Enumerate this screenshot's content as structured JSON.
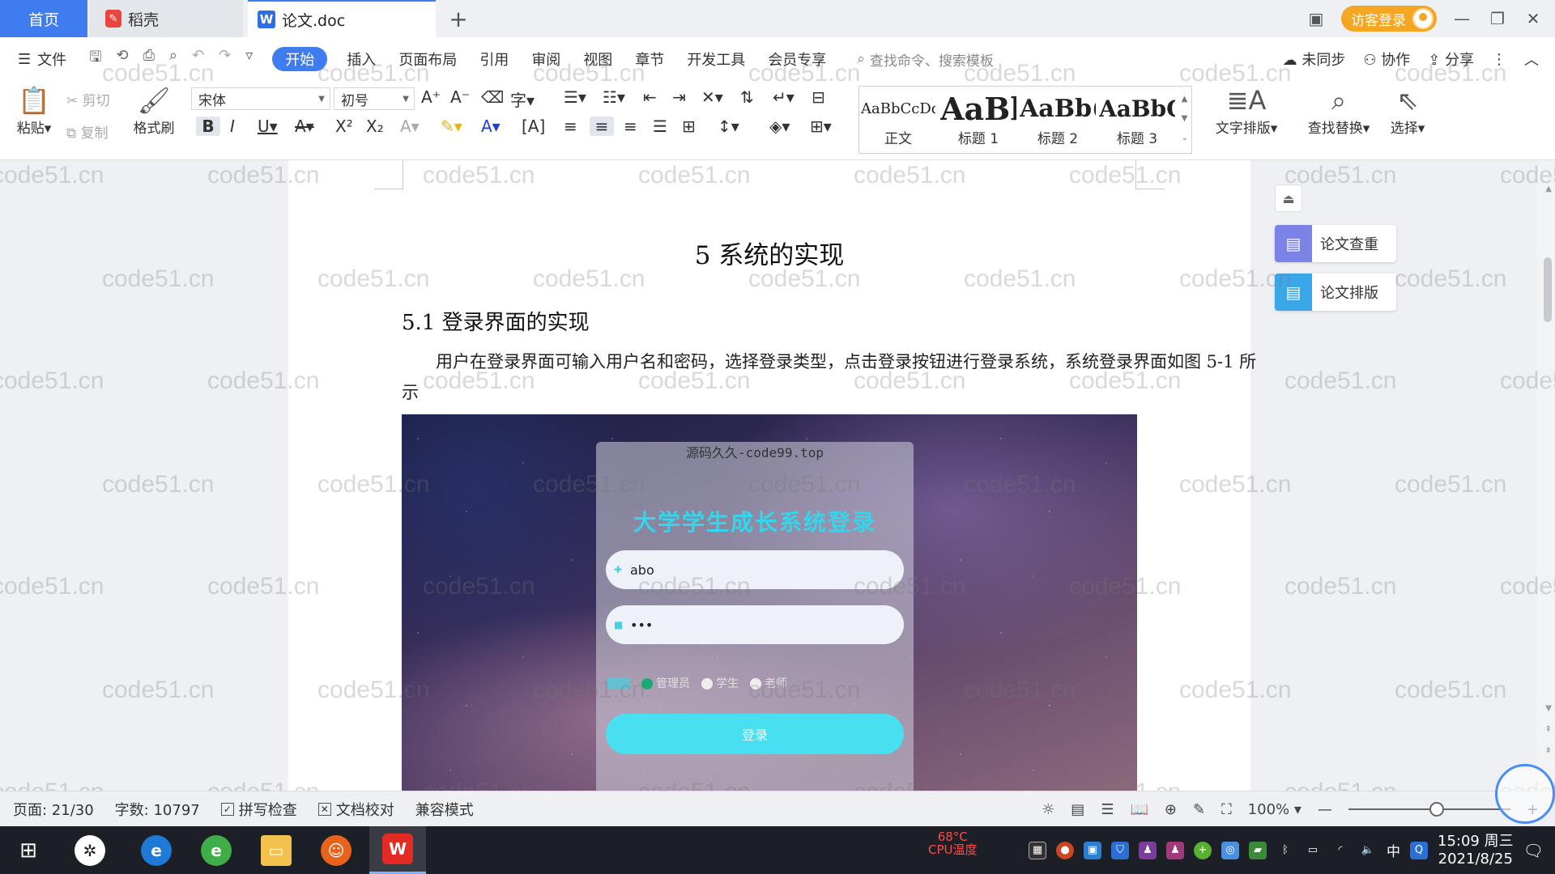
{
  "tabs": {
    "home": "首页",
    "daoke": "稻壳",
    "doc": "论文.doc",
    "daoke_icon": "daoke-icon",
    "doc_icon": "word-doc-icon"
  },
  "window": {
    "visitor_login": "访客登录"
  },
  "menu": {
    "file": "文件",
    "start": "开始",
    "insert": "插入",
    "layout": "页面布局",
    "reference": "引用",
    "review": "审阅",
    "view": "视图",
    "chapter": "章节",
    "devtools": "开发工具",
    "member": "会员专享",
    "search_placeholder": "查找命令、搜索模板",
    "unsynced": "未同步",
    "collab": "协作",
    "share": "分享"
  },
  "ribbon": {
    "paste": "粘贴",
    "cut": "剪切",
    "copy": "复制",
    "format_painter": "格式刷",
    "font_name": "宋体",
    "font_size": "初号",
    "styles": [
      {
        "preview": "AaBbCcDd",
        "name": "正文"
      },
      {
        "preview": "AaBl",
        "name": "标题 1"
      },
      {
        "preview": "AaBb(",
        "name": "标题 2"
      },
      {
        "preview": "AaBbC",
        "name": "标题 3"
      }
    ],
    "text_layout": "文字排版",
    "find_replace": "查找替换",
    "select": "选择"
  },
  "document": {
    "chapter_title": "5  系统的实现",
    "section_title": "5.1 登录界面的实现",
    "paragraph": "用户在登录界面可输入用户名和密码，选择登录类型，点击登录按钮进行登录系统，系统登录界面如图 5-1 所示",
    "figure": {
      "watermark": "源码久久-code99.top",
      "title": "大学学生成长系统登录",
      "username": "abo",
      "password": "•••",
      "roles": [
        "管理员",
        "学生",
        "老师"
      ],
      "selected_role": "管理员",
      "login_button": "登录"
    }
  },
  "side_panel": {
    "check": "论文查重",
    "format": "论文排版"
  },
  "watermark_text": "code51.cn",
  "status": {
    "page": "页面: 21/30",
    "words": "字数: 10797",
    "spell_check": "拼写检查",
    "doc_proof": "文档校对",
    "compat_mode": "兼容模式",
    "zoom": "100%"
  },
  "taskbar": {
    "cpu_line1": "68°C",
    "cpu_line2": "CPU温度",
    "ime": "中",
    "time": "15:09 周三",
    "date": "2021/8/25"
  },
  "colors": {
    "accent": "#3f7cf0",
    "visitor": "#f5a623",
    "login_title": "#33d6ea"
  }
}
